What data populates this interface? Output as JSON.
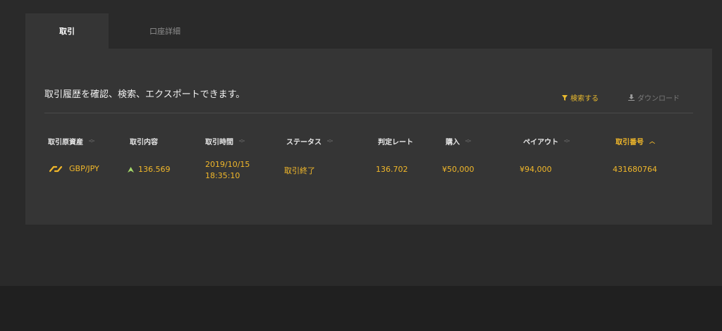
{
  "tabs": [
    {
      "label": "取引",
      "active": true
    },
    {
      "label": "口座詳細",
      "active": false
    }
  ],
  "panel": {
    "description": "取引履歴を確認、検索、エクスポートできます。",
    "actions": {
      "search_label": "検索する",
      "search_icon": "filter-icon",
      "download_label": "ダウンロード",
      "download_icon": "download-icon"
    }
  },
  "table": {
    "columns": [
      {
        "label": "取引原資産",
        "sort": "none"
      },
      {
        "label": "取引内容",
        "sort": "none"
      },
      {
        "label": "取引時間",
        "sort": "none"
      },
      {
        "label": "ステータス",
        "sort": "none"
      },
      {
        "label": "判定レート",
        "sort": "none"
      },
      {
        "label": "購入",
        "sort": "none"
      },
      {
        "label": "ペイアウト",
        "sort": "none"
      },
      {
        "label": "取引番号",
        "sort": "asc"
      }
    ],
    "rows": [
      {
        "asset": "GBP/JPY",
        "asset_icon": "currency-pair-icon",
        "direction_icon": "up-arrow-icon",
        "content": "136.569",
        "time_date": "2019/10/15",
        "time_clock": "18:35:10",
        "status": "取引終了",
        "rate": "136.702",
        "purchase": "¥50,000",
        "payout": "¥94,000",
        "trade_id": "431680764"
      }
    ]
  },
  "colors": {
    "accent": "#f2b82a",
    "up": "#a6d96a",
    "background": "#2a2a2a",
    "panel": "#353535"
  }
}
